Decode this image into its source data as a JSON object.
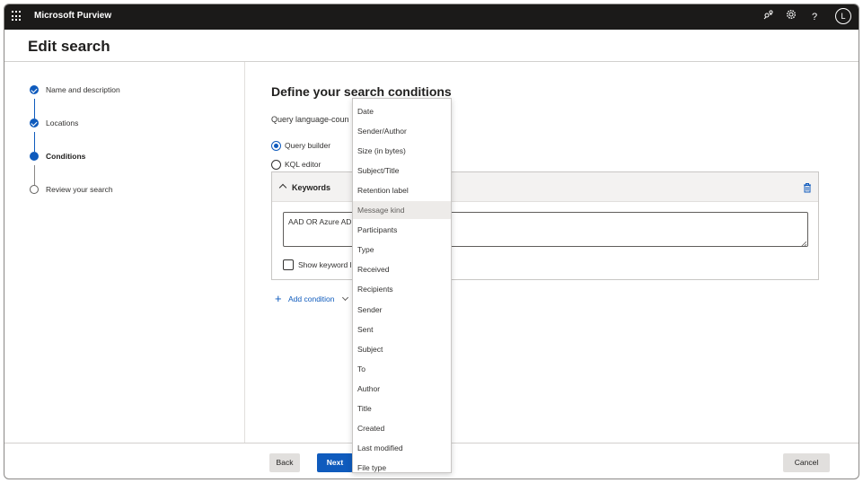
{
  "topbar": {
    "app_name": "Microsoft Purview",
    "avatar_initial": "L",
    "help_label": "?"
  },
  "page": {
    "title": "Edit search"
  },
  "steps": [
    {
      "label": "Name and description",
      "state": "done"
    },
    {
      "label": "Locations",
      "state": "done"
    },
    {
      "label": "Conditions",
      "state": "current"
    },
    {
      "label": "Review your search",
      "state": "todo"
    }
  ],
  "main": {
    "title": "Define your search conditions",
    "query_language_label": "Query language-coun",
    "radio_query_builder": "Query builder",
    "radio_kql_editor": "KQL editor",
    "keywords_title": "Keywords",
    "keywords_value": "AAD OR Azure AD",
    "show_keyword_label": "Show keyword l",
    "add_condition": "Add condition"
  },
  "footer": {
    "back": "Back",
    "next": "Next",
    "cancel": "Cancel"
  },
  "dropdown": {
    "items": [
      "Date",
      "Sender/Author",
      "Size (in bytes)",
      "Subject/Title",
      "Retention label",
      "Message kind",
      "Participants",
      "Type",
      "Received",
      "Recipients",
      "Sender",
      "Sent",
      "Subject",
      "To",
      "Author",
      "Title",
      "Created",
      "Last modified",
      "File type"
    ],
    "hover_item": "Message kind"
  },
  "colors": {
    "accent": "#0f5bbd",
    "topbar": "#1b1a19"
  }
}
